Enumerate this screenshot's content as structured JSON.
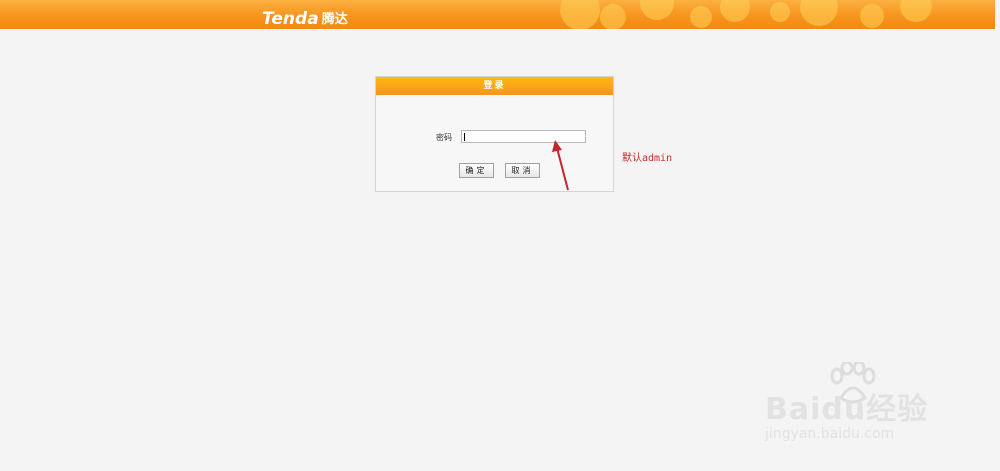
{
  "header": {
    "logo_en": "Tenda",
    "logo_cn": "腾达"
  },
  "login": {
    "title": "登录",
    "password_label": "密码",
    "password_value": "",
    "ok_label": "确定",
    "cancel_label": "取消"
  },
  "annotation": {
    "text": "默认admin",
    "color": "#cc2a2a"
  },
  "watermark": {
    "brand": "Baidu经验",
    "url": "jingyan.baidu.com"
  },
  "colors": {
    "banner_orange": "#f7941d",
    "header_yellow": "#fdb913",
    "page_bg": "#f4f4f4"
  }
}
